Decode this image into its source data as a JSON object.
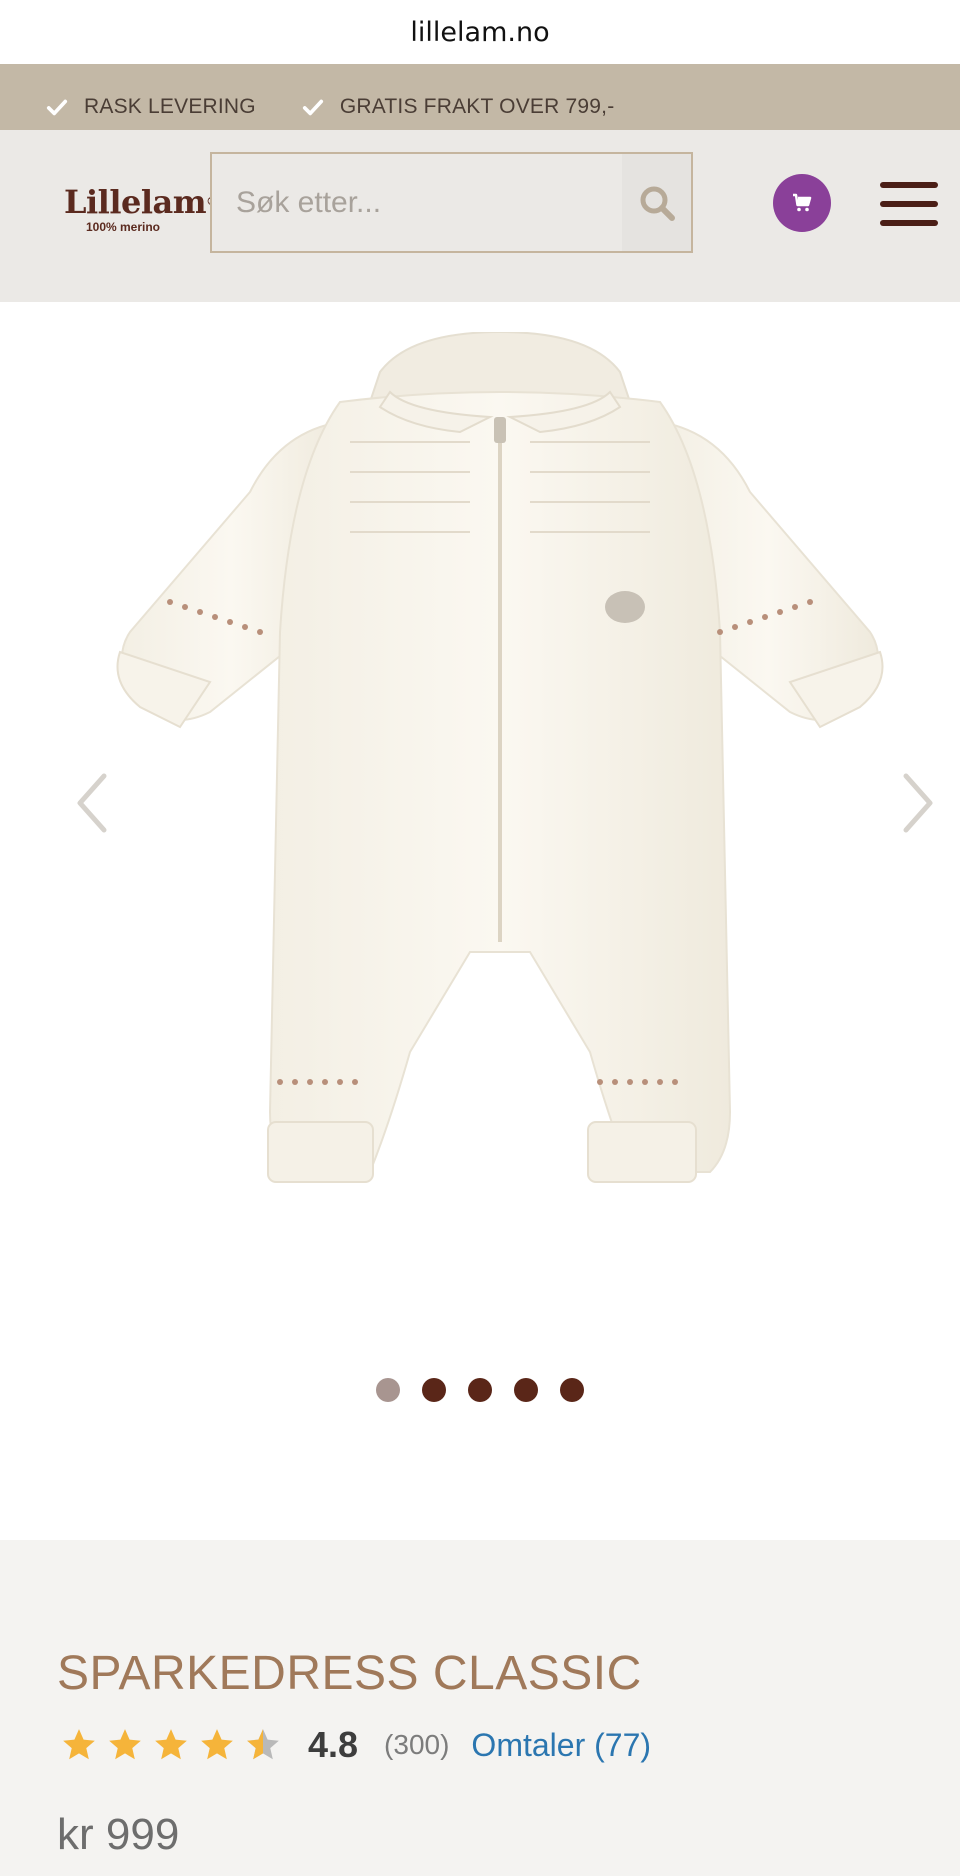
{
  "browser": {
    "url": "lillelam.no"
  },
  "promo": {
    "items": [
      {
        "icon": "check-icon",
        "label": "RASK LEVERING"
      },
      {
        "icon": "check-icon",
        "label": "GRATIS FRAKT OVER 799,-"
      }
    ]
  },
  "header": {
    "logo": {
      "brand": "Lillelam",
      "tagline": "100% merino"
    },
    "search": {
      "placeholder": "Søk etter..."
    }
  },
  "gallery": {
    "slide_count": 5,
    "active_slide": 1
  },
  "product": {
    "title": "SPARKEDRESS CLASSIC",
    "rating": 4.8,
    "rating_display": "4.8",
    "rating_count": "(300)",
    "reviews_link": "Omtaler (77)",
    "price": "kr 999"
  },
  "colors": {
    "promo_bg": "#c3b8a6",
    "header_bg": "#ebe9e6",
    "accent_purple": "#8a4099",
    "title_brown": "#a0795a",
    "star": "#f5b43a",
    "link_blue": "#2b76b0"
  }
}
